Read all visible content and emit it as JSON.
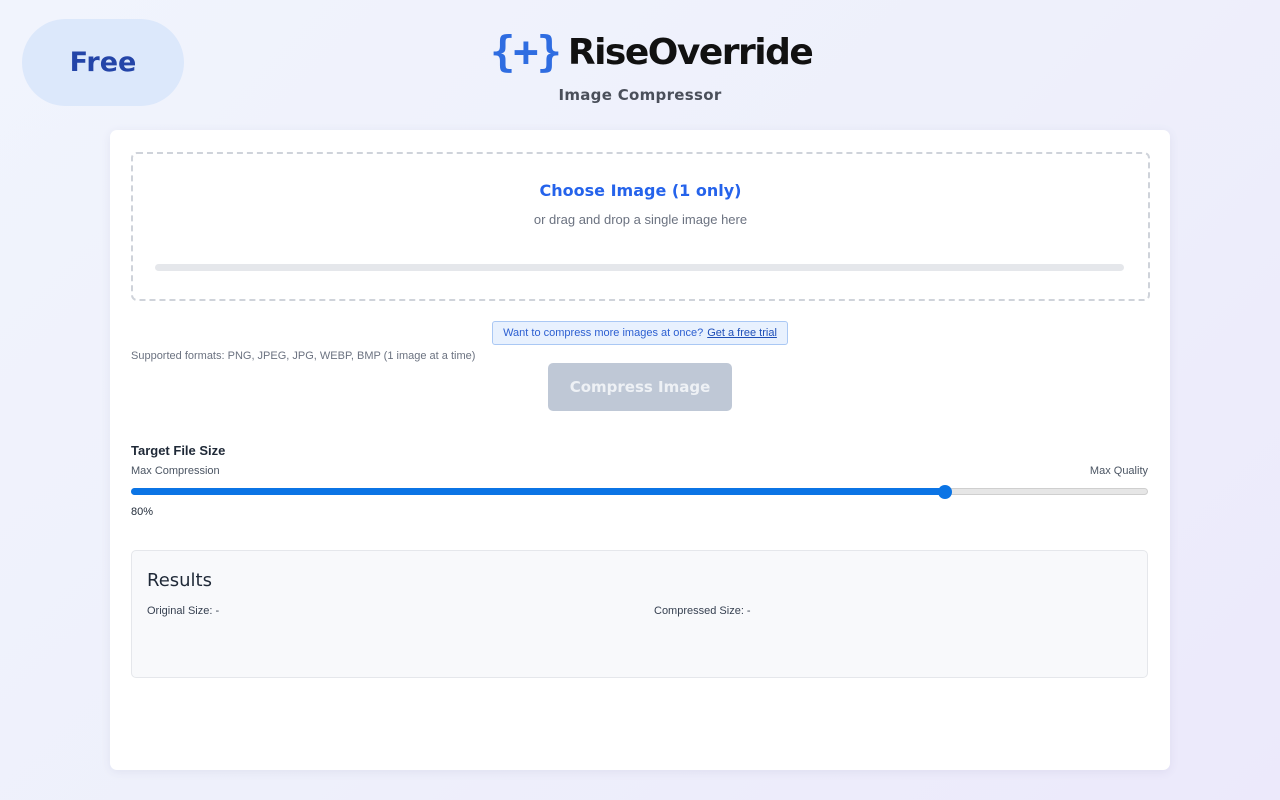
{
  "badge": {
    "label": "Free"
  },
  "brand": {
    "mark": "{+}",
    "name": "RiseOverride",
    "subtitle": "Image Compressor"
  },
  "upload": {
    "choose_label": "Choose Image (1 only)",
    "drop_hint": "or drag and drop a single image here",
    "progress": 0
  },
  "trial": {
    "text": "Want to compress more images at once?",
    "link": "Get a free trial"
  },
  "formats": "Supported formats: PNG, JPEG, JPG, WEBP, BMP (1 image at a time)",
  "compress_button": "Compress Image",
  "target": {
    "label": "Target File Size",
    "min_label": "Max Compression",
    "max_label": "Max Quality",
    "value": 80,
    "value_text": "80%"
  },
  "results": {
    "title": "Results",
    "original": "Original Size: -",
    "compressed": "Compressed Size: -"
  },
  "colors": {
    "accent": "#2563eb",
    "slider": "#0b74e5",
    "badge_bg": "#dce8fb",
    "badge_text": "#2445a8"
  }
}
